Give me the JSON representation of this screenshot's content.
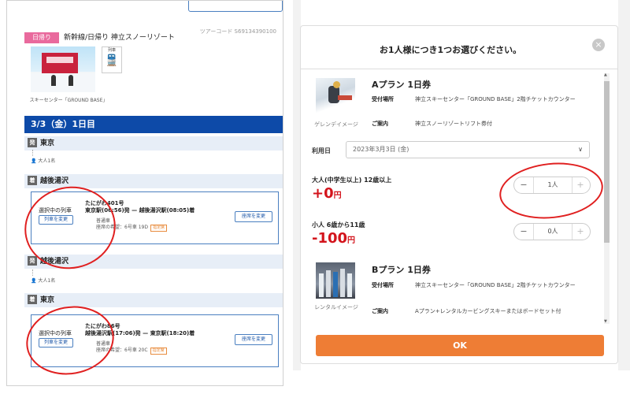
{
  "itinerary": {
    "tour_code": "ツアーコード S69134390100",
    "badge": "日帰り",
    "title": "新幹線/日帰り 神立スノーリゾート",
    "image_caption": "スキーセンター「GROUND BASE」",
    "transport_icon_label": "列車",
    "transport_icon": "train-icon",
    "day_header": "3/3（金）1日目",
    "segments": [
      {
        "depart_tag": "発",
        "depart_station": "東京",
        "passengers": "大人1名",
        "arrive_tag": "着",
        "arrive_station": "越後湯沢",
        "selected_label": "選択中の列車",
        "change_train": "列車を変更",
        "train_name": "たにがわ401号",
        "route_from": "東京駅(06:56)発",
        "route_to": "越後湯沢駅(08:05)着",
        "train_type": "普通車",
        "seat": "座席の希望：6号車 19D",
        "seat_tag": "指定席",
        "change_seat": "座席を変更"
      },
      {
        "depart_tag": "発",
        "depart_station": "越後湯沢",
        "passengers": "大人1名",
        "arrive_tag": "着",
        "arrive_station": "東京",
        "selected_label": "選択中の列車",
        "change_train": "列車を変更",
        "train_name": "たにがわ86号",
        "route_from": "越後湯沢駅(17:06)発",
        "route_to": "東京駅(18:20)着",
        "train_type": "普通車",
        "seat": "座席の希望：6号車 20C",
        "seat_tag": "指定席",
        "change_seat": "座席を変更"
      }
    ]
  },
  "modal": {
    "title": "お1人様につき1つお選びください。",
    "close": "×",
    "plans": [
      {
        "title": "Aプラン 1日券",
        "image_caption": "ゲレンデイメージ",
        "reception_key": "受付場所",
        "reception_value": "神立スキーセンター「GROUND BASE」2階チケットカウンター",
        "info_key": "ご案内",
        "info_value": "神立スノーリゾートリフト券付"
      },
      {
        "title": "Bプラン 1日券",
        "image_caption": "レンタルイメージ",
        "reception_key": "受付場所",
        "reception_value": "神立スキーセンター「GROUND BASE」2階チケットカウンター",
        "info_key": "ご案内",
        "info_value": "Aプラン+レンタルカービングスキーまたはボードセット付"
      }
    ],
    "date_label": "利用日",
    "date_value": "2023年3月3日 (金)",
    "date_chevron": "∨",
    "pax": [
      {
        "type": "大人(中学生以上) 12歳以上",
        "price": "+0",
        "unit": "円",
        "minus": "−",
        "value": "1人",
        "plus": "+"
      },
      {
        "type": "小人 6歳から11歳",
        "price": "-100",
        "unit": "円",
        "minus": "−",
        "value": "0人",
        "plus": "+"
      }
    ],
    "ok": "OK"
  },
  "colors": {
    "brand_blue": "#0d4aa8",
    "price_red": "#d3141c",
    "ok_orange": "#ee7d35",
    "badge_pink": "#e96a9d",
    "annotation_red": "#e02020"
  }
}
